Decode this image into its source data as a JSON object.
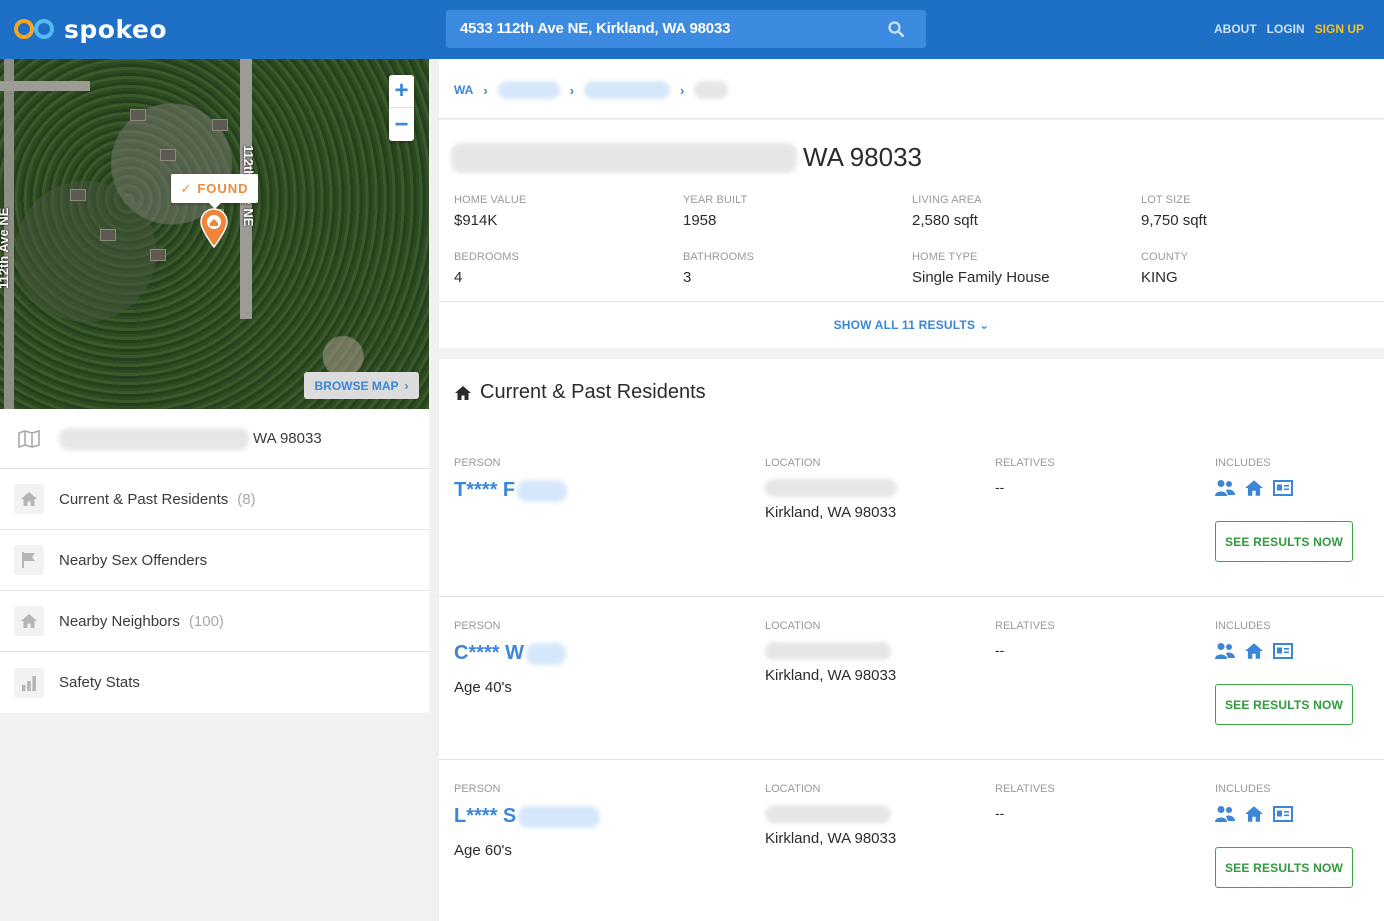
{
  "header": {
    "logo_text": "spokeo",
    "search_value": "4533 112th Ave NE, Kirkland, WA 98033",
    "nav": {
      "about": "ABOUT",
      "login": "LOGIN",
      "signup": "SIGN UP"
    },
    "colors": {
      "bar": "#1e6fc6",
      "signup": "#f5c020"
    }
  },
  "map": {
    "found_label": "FOUND",
    "street_label_left": "112th Ave NE",
    "street_label_right": "112th Ave NE",
    "browse_label": "BROWSE MAP",
    "zoom_in": "+",
    "zoom_out": "−"
  },
  "sidebar": {
    "address_suffix": "WA 98033",
    "items": [
      {
        "label": "Current & Past Residents",
        "count": "(8)",
        "icon": "home-icon"
      },
      {
        "label": "Nearby Sex Offenders",
        "count": "",
        "icon": "flag-icon"
      },
      {
        "label": "Nearby Neighbors",
        "count": "(100)",
        "icon": "home-icon"
      },
      {
        "label": "Safety Stats",
        "count": "",
        "icon": "bar-chart-icon"
      }
    ]
  },
  "breadcrumb": {
    "state": "WA"
  },
  "property": {
    "title_suffix": "WA 98033",
    "facts": [
      {
        "label": "HOME VALUE",
        "value": "$914K"
      },
      {
        "label": "YEAR BUILT",
        "value": "1958"
      },
      {
        "label": "LIVING AREA",
        "value": "2,580 sqft"
      },
      {
        "label": "LOT SIZE",
        "value": "9,750 sqft"
      },
      {
        "label": "BEDROOMS",
        "value": "4"
      },
      {
        "label": "BATHROOMS",
        "value": "3"
      },
      {
        "label": "HOME TYPE",
        "value": "Single Family House"
      },
      {
        "label": "COUNTY",
        "value": "KING"
      }
    ],
    "show_all": "SHOW ALL 11 RESULTS"
  },
  "residents": {
    "title": "Current & Past Residents",
    "labels": {
      "person": "PERSON",
      "location": "LOCATION",
      "relatives": "RELATIVES",
      "includes": "INCLUDES"
    },
    "button": "SEE RESULTS NOW",
    "rows": [
      {
        "name": "T**** F",
        "age": "",
        "city": "Kirkland, WA 98033",
        "relatives": "--"
      },
      {
        "name": "C**** W",
        "age": "Age 40's",
        "city": "Kirkland, WA 98033",
        "relatives": "--"
      },
      {
        "name": "L**** S",
        "age": "Age 60's",
        "city": "Kirkland, WA 98033",
        "relatives": "--"
      }
    ]
  }
}
